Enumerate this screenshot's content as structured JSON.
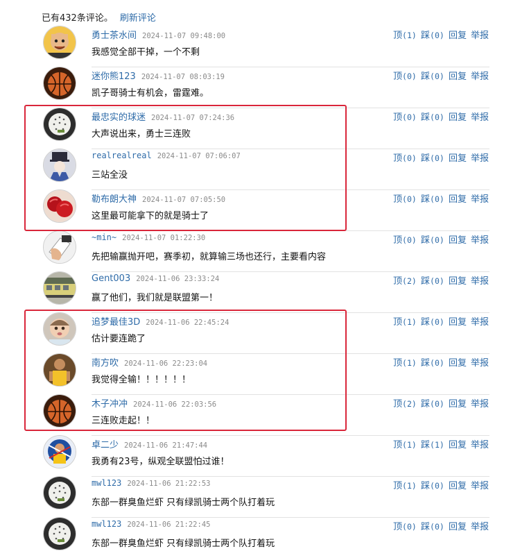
{
  "header": {
    "count_text": "已有432条评论。",
    "refresh_label": "刷新评论"
  },
  "labels": {
    "up": "顶",
    "down": "踩",
    "reply": "回复",
    "report": "举报"
  },
  "comments": [
    {
      "user": "勇士茶水间",
      "time": "2024-11-07 09:48:00",
      "text": "我感觉全部干掉，一个不剩",
      "up": "(1)",
      "down": "(0)",
      "avatar": "cartoon-bald-man"
    },
    {
      "user": "迷你熊123",
      "time": "2024-11-07 08:03:19",
      "text": "凯子哥骑士有机会，雷霆难。",
      "up": "(0)",
      "down": "(0)",
      "avatar": "basketball"
    },
    {
      "user": "最忠实的球迷",
      "time": "2024-11-07 07:24:36",
      "text": "大声说出来，勇士三连败",
      "up": "(0)",
      "down": "(0)",
      "avatar": "white-ball"
    },
    {
      "user": "realrealreal",
      "time": "2024-11-07 07:06:07",
      "text": "三站全没",
      "up": "(0)",
      "down": "(0)",
      "avatar": "anime-character"
    },
    {
      "user": "勒布朗大神",
      "time": "2024-11-07 07:05:50",
      "text": "这里最可能拿下的就是骑士了",
      "up": "(0)",
      "down": "(0)",
      "avatar": "red-gloves"
    },
    {
      "user": "~min~",
      "time": "2024-11-07 01:22:30",
      "text": "先把输赢抛开吧，赛季初，就算输三场也还行，主要看内容",
      "up": "(0)",
      "down": "(0)",
      "avatar": "hand-photo"
    },
    {
      "user": "Gent003",
      "time": "2024-11-06 23:33:24",
      "text": "赢了他们，我们就是联盟第一！",
      "up": "(2)",
      "down": "(0)",
      "avatar": "train"
    },
    {
      "user": "追梦最佳3D",
      "time": "2024-11-06 22:45:24",
      "text": "估计要连跪了",
      "up": "(1)",
      "down": "(0)",
      "avatar": "baby"
    },
    {
      "user": "南方吹",
      "time": "2024-11-06 22:23:04",
      "text": "我觉得全输！！！！！！",
      "up": "(1)",
      "down": "(0)",
      "avatar": "player"
    },
    {
      "user": "木子冲冲",
      "time": "2024-11-06 22:03:56",
      "text": "三连败走起！！",
      "up": "(2)",
      "down": "(0)",
      "avatar": "basketball"
    },
    {
      "user": "卓二少",
      "time": "2024-11-06 21:47:44",
      "text": "我勇有23号，纵观全联盟怕过谁！",
      "up": "(1)",
      "down": "(1)",
      "avatar": "jersey-player"
    },
    {
      "user": "mwl123",
      "time": "2024-11-06 21:22:53",
      "text": "东部一群臭鱼烂虾 只有绿凯骑士两个队打着玩",
      "up": "(1)",
      "down": "(0)",
      "avatar": "white-ball"
    },
    {
      "user": "mwl123",
      "time": "2024-11-06 21:22:45",
      "text": "东部一群臭鱼烂虾 只有绿凯骑士两个队打着玩",
      "up": "(0)",
      "down": "(0)",
      "avatar": "white-ball"
    }
  ],
  "colors": {
    "link": "#2e6ba8",
    "highlight": "#d9263a",
    "time": "#8a8a8a"
  }
}
